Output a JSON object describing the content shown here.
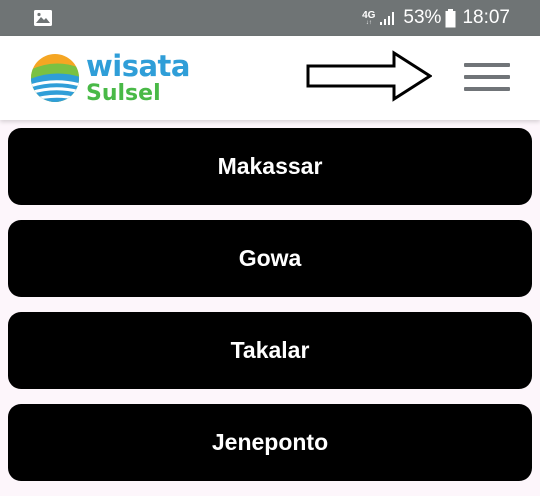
{
  "status_bar": {
    "network_main": "4G",
    "network_sub": "↓↑",
    "battery_percent": "53%",
    "time": "18:07",
    "icons": [
      "image-notification-icon",
      "signal-icon",
      "battery-icon"
    ]
  },
  "header": {
    "logo_line1": "wisata",
    "logo_line2": "Sulsel",
    "menu_icon": "hamburger-menu-icon",
    "annotation_icon": "right-arrow-icon"
  },
  "regions": [
    {
      "label": "Makassar"
    },
    {
      "label": "Gowa"
    },
    {
      "label": "Takalar"
    },
    {
      "label": "Jeneponto"
    }
  ],
  "colors": {
    "status_bar": "#6f7475",
    "header_bg": "#ffffff",
    "page_bg": "#fdf6fb",
    "button_bg": "#000000",
    "button_text": "#ffffff",
    "logo_blue": "#2f9ed8",
    "logo_green": "#49b947"
  }
}
